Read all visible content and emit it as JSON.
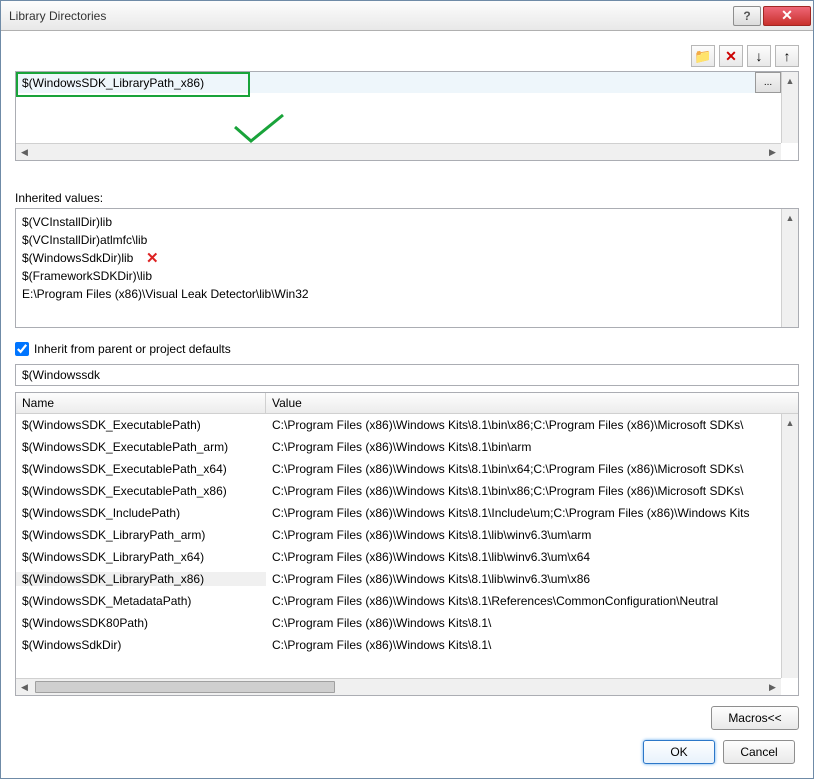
{
  "title": "Library Directories",
  "toolbar": {
    "new_folder": "📁",
    "delete_label": "✕",
    "down_label": "↓",
    "up_label": "↑"
  },
  "editor": {
    "current_value": "$(WindowsSDK_LibraryPath_x86)",
    "browse_label": "..."
  },
  "inherited_label": "Inherited values:",
  "inherited": [
    "$(VCInstallDir)lib",
    "$(VCInstallDir)atlmfc\\lib",
    "$(WindowsSdkDir)lib",
    "$(FrameworkSDKDir)\\lib",
    "E:\\Program Files (x86)\\Visual Leak Detector\\lib\\Win32"
  ],
  "inherit_checkbox_label": "Inherit from parent or project defaults",
  "inherit_checked": true,
  "filter_value": "$(Windowssdk",
  "macros_header": {
    "name": "Name",
    "value": "Value"
  },
  "macros": [
    {
      "name": "$(WindowsSDK_ExecutablePath)",
      "value": "C:\\Program Files (x86)\\Windows Kits\\8.1\\bin\\x86;C:\\Program Files (x86)\\Microsoft SDKs\\"
    },
    {
      "name": "$(WindowsSDK_ExecutablePath_arm)",
      "value": "C:\\Program Files (x86)\\Windows Kits\\8.1\\bin\\arm"
    },
    {
      "name": "$(WindowsSDK_ExecutablePath_x64)",
      "value": "C:\\Program Files (x86)\\Windows Kits\\8.1\\bin\\x64;C:\\Program Files (x86)\\Microsoft SDKs\\"
    },
    {
      "name": "$(WindowsSDK_ExecutablePath_x86)",
      "value": "C:\\Program Files (x86)\\Windows Kits\\8.1\\bin\\x86;C:\\Program Files (x86)\\Microsoft SDKs\\"
    },
    {
      "name": "$(WindowsSDK_IncludePath)",
      "value": "C:\\Program Files (x86)\\Windows Kits\\8.1\\Include\\um;C:\\Program Files (x86)\\Windows Kits"
    },
    {
      "name": "$(WindowsSDK_LibraryPath_arm)",
      "value": "C:\\Program Files (x86)\\Windows Kits\\8.1\\lib\\winv6.3\\um\\arm"
    },
    {
      "name": "$(WindowsSDK_LibraryPath_x64)",
      "value": "C:\\Program Files (x86)\\Windows Kits\\8.1\\lib\\winv6.3\\um\\x64"
    },
    {
      "name": "$(WindowsSDK_LibraryPath_x86)",
      "value": "C:\\Program Files (x86)\\Windows Kits\\8.1\\lib\\winv6.3\\um\\x86",
      "selected": true
    },
    {
      "name": "$(WindowsSDK_MetadataPath)",
      "value": "C:\\Program Files (x86)\\Windows Kits\\8.1\\References\\CommonConfiguration\\Neutral"
    },
    {
      "name": "$(WindowsSDK80Path)",
      "value": "C:\\Program Files (x86)\\Windows Kits\\8.1\\"
    },
    {
      "name": "$(WindowsSdkDir)",
      "value": "C:\\Program Files (x86)\\Windows Kits\\8.1\\"
    }
  ],
  "macros_button": "Macros<<",
  "ok_label": "OK",
  "cancel_label": "Cancel"
}
